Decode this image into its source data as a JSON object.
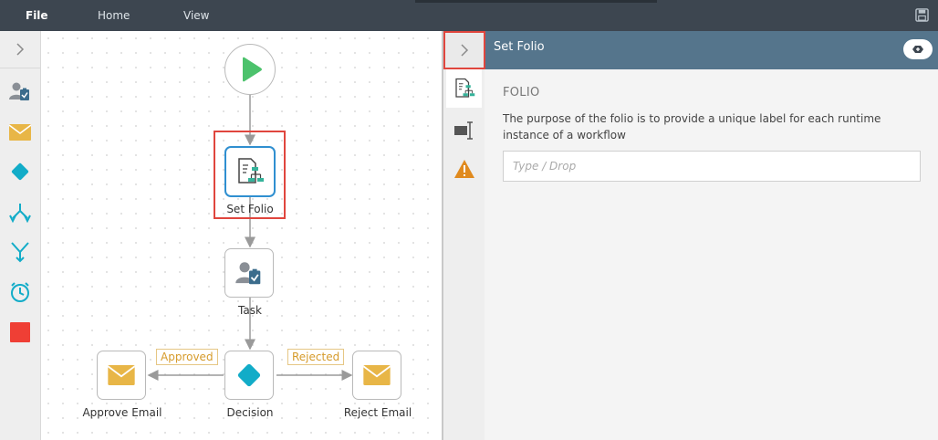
{
  "menu": {
    "file": "File",
    "home": "Home",
    "view": "View"
  },
  "nodes": {
    "set_folio": "Set Folio",
    "task": "Task",
    "decision": "Decision",
    "approve_email": "Approve Email",
    "reject_email": "Reject Email"
  },
  "branches": {
    "approved": "Approved",
    "rejected": "Rejected"
  },
  "panel": {
    "title": "Set Folio",
    "section_title": "FOLIO",
    "description": "The purpose of the folio is to provide a unique label for each runtime instance of a workflow",
    "input_placeholder": "Type / Drop"
  },
  "colors": {
    "topbar": "#3d4650",
    "panel_header": "#55758c",
    "start_green": "#4cc26c",
    "email_yellow": "#e8b647",
    "decision_teal": "#12acc8",
    "highlight_red": "#e0463e",
    "selected_blue": "#2f8fd0",
    "branch_text": "#d69b2b"
  }
}
